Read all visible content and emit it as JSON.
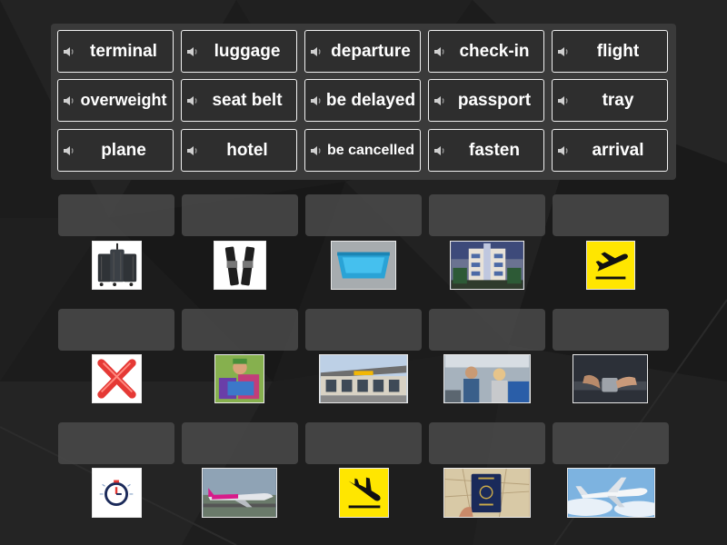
{
  "word_bank": {
    "tiles": [
      {
        "label": "terminal",
        "speaker_icon": "speaker-icon"
      },
      {
        "label": "luggage",
        "speaker_icon": "speaker-icon"
      },
      {
        "label": "departure",
        "speaker_icon": "speaker-icon"
      },
      {
        "label": "check-in",
        "speaker_icon": "speaker-icon"
      },
      {
        "label": "flight",
        "speaker_icon": "speaker-icon"
      },
      {
        "label": "overweight",
        "speaker_icon": "speaker-icon"
      },
      {
        "label": "seat belt",
        "speaker_icon": "speaker-icon"
      },
      {
        "label": "be delayed",
        "speaker_icon": "speaker-icon"
      },
      {
        "label": "passport",
        "speaker_icon": "speaker-icon"
      },
      {
        "label": "tray",
        "speaker_icon": "speaker-icon"
      },
      {
        "label": "plane",
        "speaker_icon": "speaker-icon"
      },
      {
        "label": "hotel",
        "speaker_icon": "speaker-icon"
      },
      {
        "label": "be cancelled",
        "speaker_icon": "speaker-icon"
      },
      {
        "label": "fasten",
        "speaker_icon": "speaker-icon"
      },
      {
        "label": "arrival",
        "speaker_icon": "speaker-icon"
      }
    ]
  },
  "drop_rows": [
    {
      "images": [
        "suitcases-image",
        "seat-belt-straps-image",
        "blue-tray-image",
        "hotel-building-image",
        "departure-sign-image"
      ]
    },
    {
      "images": [
        "red-cross-cancel-image",
        "overweight-bags-image",
        "airport-terminal-image",
        "check-in-desk-image",
        "fastening-seatbelt-image"
      ]
    },
    {
      "images": [
        "stopwatch-delay-image",
        "pink-airplane-image",
        "arrival-sign-image",
        "passport-image",
        "plane-flying-image"
      ]
    }
  ],
  "colors": {
    "background": "#1b1b1b",
    "tile_border": "#f0f0f0",
    "tile_text": "#ffffff",
    "slot": "#4a4a4a",
    "sign_yellow": "#ffe600"
  }
}
